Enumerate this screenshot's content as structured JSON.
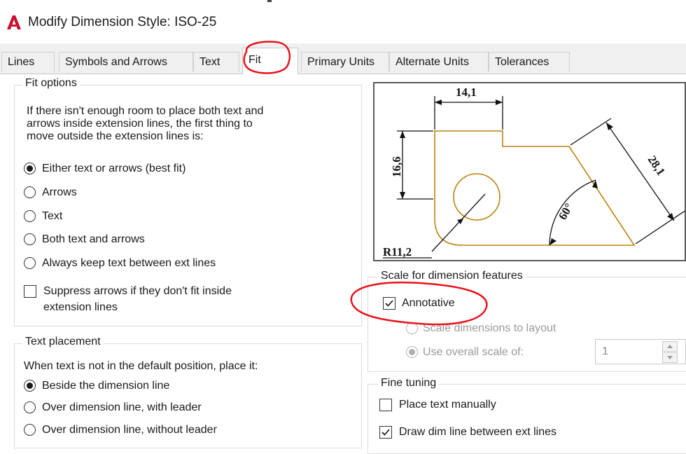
{
  "window": {
    "title": "Modify Dimension Style: ISO-25"
  },
  "tabs": [
    {
      "label": "Lines"
    },
    {
      "label": "Symbols and Arrows"
    },
    {
      "label": "Text"
    },
    {
      "label": "Fit",
      "active": true
    },
    {
      "label": "Primary Units"
    },
    {
      "label": "Alternate Units"
    },
    {
      "label": "Tolerances"
    }
  ],
  "fit_options": {
    "legend": "Fit options",
    "description": [
      "If there isn't enough room to place both text and",
      "arrows inside extension lines, the first thing to",
      "move outside the extension lines is:"
    ],
    "radios": [
      {
        "label": "Either text or arrows (best fit)",
        "selected": true
      },
      {
        "label": "Arrows",
        "selected": false
      },
      {
        "label": "Text",
        "selected": false
      },
      {
        "label": "Both text and arrows",
        "selected": false
      },
      {
        "label": "Always keep text between ext lines",
        "selected": false
      }
    ],
    "suppress": {
      "label_line1": "Suppress arrows if they don't fit inside",
      "label_line2": "extension lines",
      "checked": false
    }
  },
  "text_placement": {
    "legend": "Text placement",
    "description": "When text is not in the default position, place it:",
    "radios": [
      {
        "label": "Beside the dimension line",
        "selected": true
      },
      {
        "label": "Over dimension line, with leader",
        "selected": false
      },
      {
        "label": "Over dimension line, without leader",
        "selected": false
      }
    ]
  },
  "preview": {
    "dim_top": "14,1",
    "dim_left": "16,6",
    "dim_right": "28,1",
    "dim_angle": "60°",
    "dim_radius": "R11,2"
  },
  "scale": {
    "legend": "Scale for dimension features",
    "annotative": {
      "label": "Annotative",
      "checked": true
    },
    "scale_to_layout": {
      "label": "Scale dimensions to layout",
      "selected": false
    },
    "overall_scale": {
      "label": "Use overall scale of:",
      "selected": true,
      "value": "1"
    }
  },
  "fine_tuning": {
    "legend": "Fine tuning",
    "place_text_manually": {
      "label": "Place text manually",
      "checked": false
    },
    "draw_dim_line": {
      "label": "Draw dim line between ext lines",
      "checked": true
    }
  },
  "colors": {
    "annotation_red": "#e8131a",
    "preview_part": "#b8860b",
    "autocad_red": "#c8102e"
  }
}
